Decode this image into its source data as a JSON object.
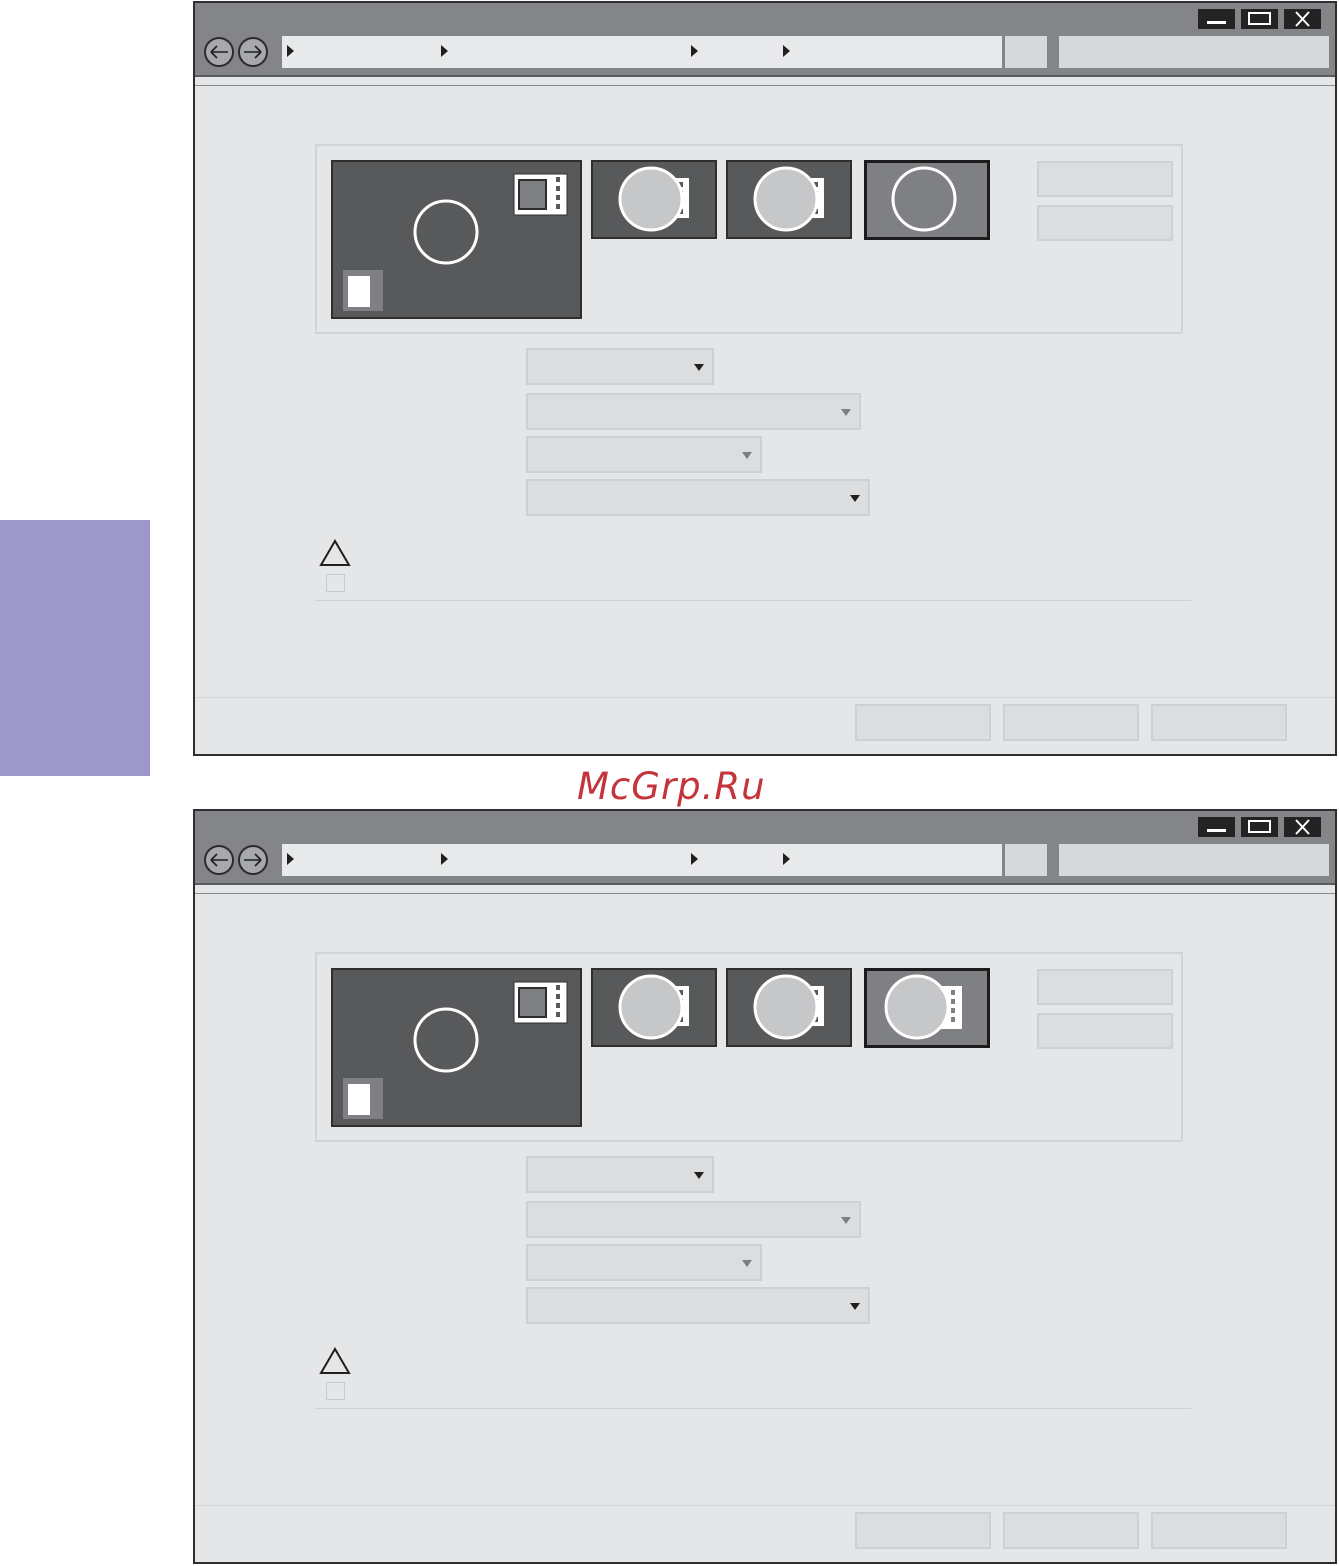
{
  "watermark": {
    "text": "McGrp.Ru"
  },
  "colors": {
    "side_tab": "#9e97c9",
    "watermark": "#c4343a",
    "titlebar": "#848588",
    "window_bg": "#e5e6e8",
    "tile_dark": "#58595b",
    "tile_selected": "#7f8083"
  },
  "icons": {
    "minimize": "minimize-icon",
    "maximize": "maximize-icon",
    "close": "close-icon",
    "back": "arrow-left-icon",
    "forward": "arrow-right-icon",
    "breadcrumb": "chevron-right-icon",
    "dropdown": "caret-down-icon",
    "warning": "warning-icon",
    "display": "monitor-icon"
  },
  "windows": [
    {
      "id": "window-1",
      "selected_tile_has_badge": false
    },
    {
      "id": "window-2",
      "selected_tile_has_badge": true
    }
  ]
}
